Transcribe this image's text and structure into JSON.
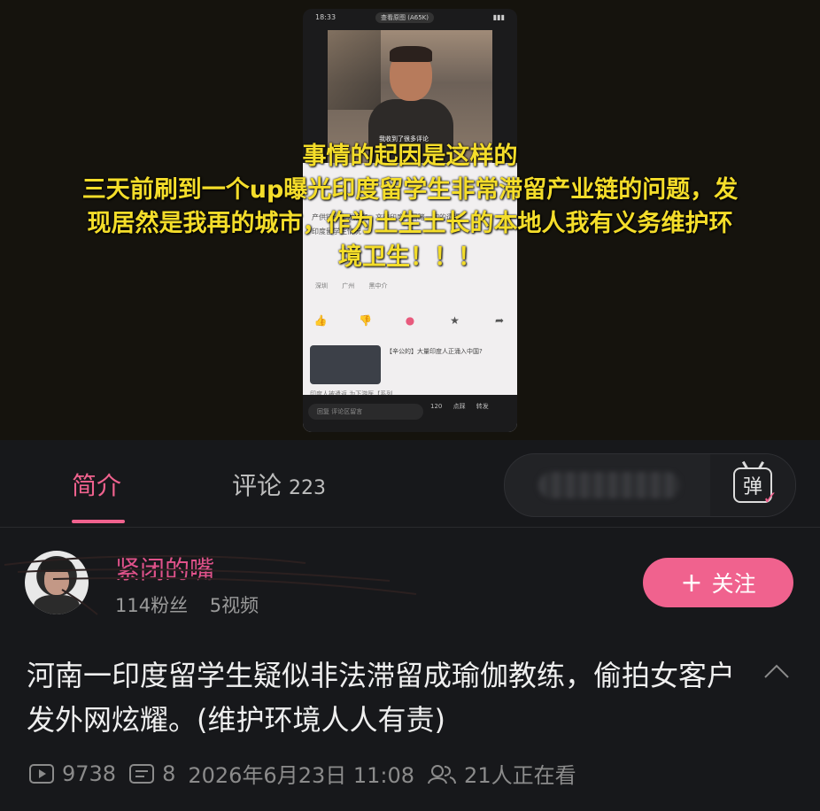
{
  "player": {
    "phone_time": "18:33",
    "phone_pill": "查看原图 (A65K)",
    "video_subtitle": "我收到了很多评论",
    "page_title_line": "产供链一条龙服务，文旅印度人目睹一切的遭遇",
    "page_sub_line": "印度留学生情况",
    "page_tags": "深圳 广州 黑中介",
    "page_card_title": "【辛公的】大量印度人正涌入中国?",
    "page_card_line": "印度人被遣返 为下游医【系列",
    "phone_input_placeholder": "回复 评论区留言",
    "phone_bottom_stats": "120 点踩 转发",
    "overlay_lines": [
      "事情的起因是这样的",
      "三天前刷到一个up曝光印度留学生非常滞留产业链的问题，发",
      "现居然是我再的城市，作为土生土长的本地人我有义务维护环",
      "境卫生！！！"
    ]
  },
  "tabs": {
    "intro_label": "简介",
    "comments_label": "评论",
    "comments_count": "223",
    "danmaku_button_label": "弹"
  },
  "uploader": {
    "name": "紧闭的嘴",
    "fans": "114粉丝",
    "videos": "5视频",
    "follow_plus": "+",
    "follow_label": "关注"
  },
  "video": {
    "title": "河南一印度留学生疑似非法滞留成瑜伽教练，偷拍女客户发外网炫耀。(维护环境人人有责)",
    "plays": "9738",
    "danmaku_count": "8",
    "date": "2026年6月23日 11:08",
    "watching": "21人正在看"
  },
  "colors": {
    "accent_pink": "#f0628e",
    "overlay_yellow": "#f4dd2a",
    "background": "#17181b"
  },
  "icons": {
    "play_count": "play-count-icon",
    "danmaku_count": "danmaku-count-icon",
    "watching": "people-icon",
    "collapse": "chevron-up-icon",
    "danmaku": "danmaku-tv-icon"
  }
}
